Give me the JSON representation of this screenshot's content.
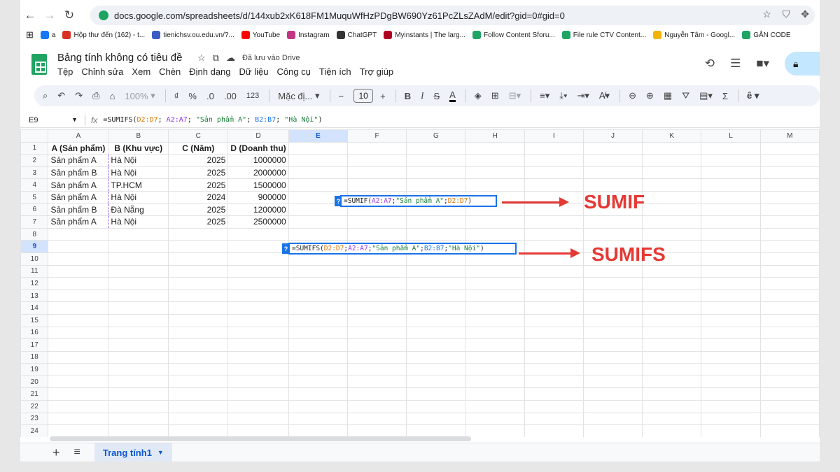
{
  "browser": {
    "url": "docs.google.com/spreadsheets/d/144xub2xK618FM1MuquWfHzPDgBW690Yz61PcZLsZAdM/edit?gid=0#gid=0",
    "bookmarks": [
      {
        "label": "a",
        "color": "#1877f2",
        "icon": "facebook-icon"
      },
      {
        "label": "Hộp thư đến (162) - t...",
        "color": "#d93025",
        "icon": "gmail-icon"
      },
      {
        "label": "tienichsv.ou.edu.vn/?...",
        "color": "#3b5cc4",
        "icon": "school-icon"
      },
      {
        "label": "YouTube",
        "color": "#ff0000",
        "icon": "youtube-icon"
      },
      {
        "label": "Instagram",
        "color": "#c13584",
        "icon": "instagram-icon"
      },
      {
        "label": "ChatGPT",
        "color": "#333333",
        "icon": "chatgpt-icon"
      },
      {
        "label": "Myinstants | The larg...",
        "color": "#b00020",
        "icon": "myinstants-icon"
      },
      {
        "label": "Follow Content Sforu...",
        "color": "#1fa463",
        "icon": "sheets-icon"
      },
      {
        "label": "File rule CTV Content...",
        "color": "#1fa463",
        "icon": "sheets-icon"
      },
      {
        "label": "Nguyễn Tâm - Googl...",
        "color": "#f4b400",
        "icon": "drive-icon"
      },
      {
        "label": "GẮN CODE",
        "color": "#1fa463",
        "icon": "sheets-icon"
      }
    ]
  },
  "doc": {
    "title": "Bảng tính không có tiêu đề",
    "saved_status": "Đã lưu vào Drive",
    "menus": [
      "Tệp",
      "Chỉnh sửa",
      "Xem",
      "Chèn",
      "Định dạng",
      "Dữ liệu",
      "Công cụ",
      "Tiện ích",
      "Trợ giúp"
    ]
  },
  "toolbar": {
    "zoom": "100%",
    "currency": "₫",
    "percent": "%",
    "dec_less": ".0",
    "dec_more": ".00",
    "number_format": "123",
    "font": "Mặc đị...",
    "font_size": "10"
  },
  "formula_bar": {
    "cell_ref": "E9",
    "fx": "fx",
    "formula": "=SUMIFS(D2:D7; A2:A7; \"Sản phẩm A\"; B2:B7; \"Hà Nội\")"
  },
  "columns": [
    "A",
    "B",
    "C",
    "D",
    "E",
    "F",
    "G",
    "H",
    "I",
    "J",
    "K",
    "L",
    "M"
  ],
  "selected_column": "E",
  "selected_row": "9",
  "row_numbers": [
    "1",
    "2",
    "3",
    "4",
    "5",
    "6",
    "7",
    "8",
    "9",
    "10",
    "11",
    "12",
    "13",
    "14",
    "15",
    "16",
    "17",
    "18",
    "19",
    "20",
    "21",
    "22",
    "23",
    "24"
  ],
  "table": {
    "headers": [
      "A (Sản phẩm)",
      "B (Khu vực)",
      "C (Năm)",
      "D (Doanh thu)"
    ],
    "rows": [
      [
        "Sản phẩm A",
        "Hà Nội",
        "2025",
        "1000000"
      ],
      [
        "Sản phẩm B",
        "Hà Nội",
        "2025",
        "2000000"
      ],
      [
        "Sản phẩm A",
        "TP.HCM",
        "2025",
        "1500000"
      ],
      [
        "Sản phẩm A",
        "Hà Nội",
        "2024",
        "900000"
      ],
      [
        "Sản phẩm B",
        "Đà Nẵng",
        "2025",
        "1200000"
      ],
      [
        "Sản phẩm A",
        "Hà Nội",
        "2025",
        "2500000"
      ]
    ]
  },
  "annotations": {
    "sumif": {
      "parts": [
        "=SUMIF(",
        "A2:A7",
        ";  ",
        "\"Sản phẩm A\"",
        ";",
        "D2:D7",
        ")"
      ],
      "label": "SUMIF"
    },
    "sumifs": {
      "parts": [
        "=SUMIFS(",
        "D2:D7",
        "; ",
        "A2:A7",
        "; ",
        "\"Sản phẩm A\"",
        "; ",
        "B2:B7",
        "; ",
        "\"Hà Nội\"",
        ")"
      ],
      "label": "SUMIFS"
    },
    "hint_mark": "?",
    "arrow_color": "#e53935"
  },
  "sheet_tab": {
    "name": "Trang tính1",
    "add": "+",
    "all_sheets": "≡"
  }
}
